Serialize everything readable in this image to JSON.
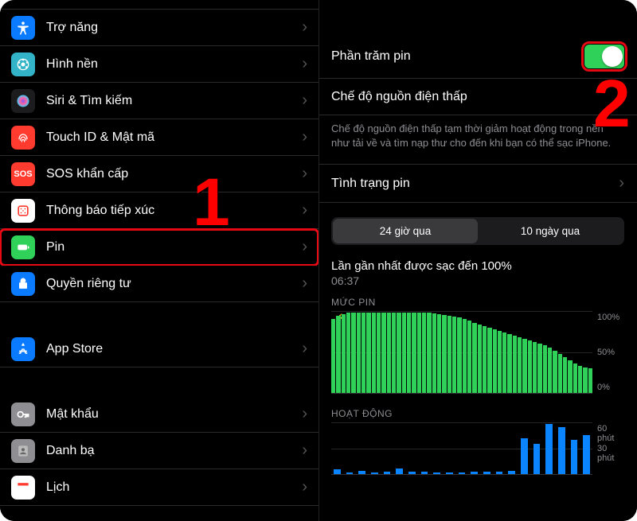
{
  "annotations": {
    "step1": "1",
    "step2": "2"
  },
  "left": {
    "partial_top_icon": "settings-blue",
    "group1": [
      {
        "icon": "accessibility",
        "label": "Trợ năng",
        "color": "#0a7aff"
      },
      {
        "icon": "wallpaper",
        "label": "Hình nền",
        "color": "#32b3c7"
      },
      {
        "icon": "siri",
        "label": "Siri & Tìm kiếm",
        "color": "#1c1c1e"
      },
      {
        "icon": "touchid",
        "label": "Touch ID & Mật mã",
        "color": "#ff3b30"
      },
      {
        "icon": "sos",
        "label": "SOS khẩn cấp",
        "color": "#ff3b30",
        "text": "SOS"
      },
      {
        "icon": "exposure",
        "label": "Thông báo tiếp xúc",
        "color": "#fff"
      },
      {
        "icon": "battery",
        "label": "Pin",
        "color": "#30d158",
        "highlight": true
      },
      {
        "icon": "privacy",
        "label": "Quyền riêng tư",
        "color": "#0a7aff"
      }
    ],
    "group2": [
      {
        "icon": "appstore",
        "label": "App Store",
        "color": "#0a7aff"
      }
    ],
    "group3": [
      {
        "icon": "key",
        "label": "Mật khẩu",
        "color": "#8e8e93"
      },
      {
        "icon": "contacts",
        "label": "Danh bạ",
        "color": "#8e8e93"
      },
      {
        "icon": "calendar",
        "label": "Lịch",
        "color": "#fff"
      }
    ]
  },
  "right": {
    "battery_percent_label": "Phần trăm pin",
    "low_power_label": "Chế độ nguồn điện thấp",
    "low_power_desc": "Chế độ nguồn điện thấp tạm thời giảm hoạt động trong nền như tải về và tìm nạp thư cho đến khi bạn có thể sạc iPhone.",
    "battery_health_label": "Tình trạng pin",
    "seg_24h": "24 giờ qua",
    "seg_10d": "10 ngày qua",
    "last_charge_label": "Lần gần nhất được sạc đến 100%",
    "last_charge_time": "06:37",
    "level_title": "MỨC PIN",
    "activity_title": "HOẠT ĐỘNG",
    "y_100": "100%",
    "y_50": "50%",
    "y_0": "0%",
    "y_60m": "60 phút",
    "y_30m": "30 phút"
  },
  "chart_data": [
    {
      "type": "bar",
      "title": "MỨC PIN",
      "ylabel": "%",
      "ylim": [
        0,
        100
      ],
      "values": [
        90,
        94,
        96,
        98,
        98,
        98,
        98,
        98,
        98,
        98,
        98,
        98,
        98,
        98,
        98,
        98,
        98,
        98,
        98,
        98,
        97,
        96,
        95,
        94,
        93,
        92,
        90,
        88,
        86,
        84,
        82,
        80,
        78,
        76,
        74,
        72,
        70,
        68,
        66,
        64,
        62,
        60,
        58,
        55,
        52,
        48,
        44,
        40,
        36,
        33,
        31,
        30
      ]
    },
    {
      "type": "bar",
      "title": "HOẠT ĐỘNG",
      "ylabel": "phút",
      "ylim": [
        0,
        60
      ],
      "values": [
        6,
        2,
        4,
        2,
        3,
        7,
        3,
        3,
        2,
        2,
        2,
        3,
        3,
        3,
        4,
        42,
        35,
        58,
        55,
        40,
        45
      ]
    }
  ],
  "icons": {
    "chevron": "›"
  }
}
